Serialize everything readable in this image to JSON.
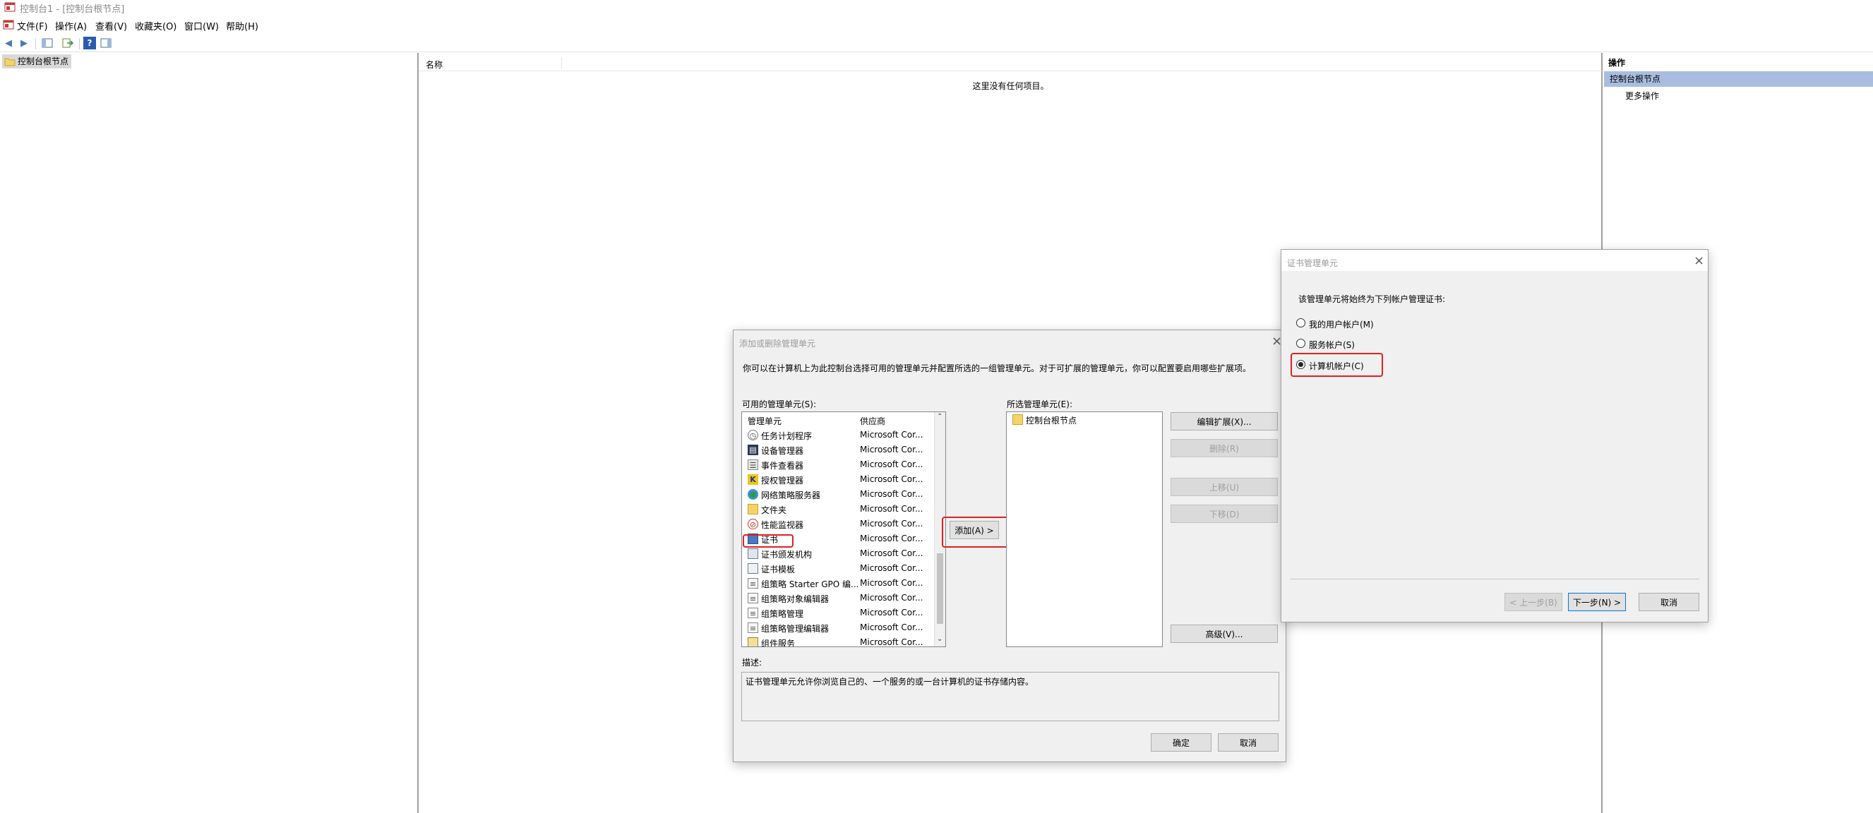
{
  "window": {
    "title": "控制台1 - [控制台根节点]"
  },
  "menu": {
    "items": [
      "文件(F)",
      "操作(A)",
      "查看(V)",
      "收藏夹(O)",
      "窗口(W)",
      "帮助(H)"
    ]
  },
  "toolbar": {
    "icons": [
      "back-arrow-icon",
      "forward-arrow-icon",
      "show-hide-tree-icon",
      "export-list-icon",
      "help-icon",
      "show-hide-action-pane-icon"
    ]
  },
  "tree": {
    "root_label": "控制台根节点"
  },
  "center": {
    "column_name": "名称",
    "empty_message": "这里没有任何项目。"
  },
  "actions": {
    "header": "操作",
    "selected": "控制台根节点",
    "more": "更多操作"
  },
  "add_remove_dialog": {
    "title": "添加或删除管理单元",
    "intro": "你可以在计算机上为此控制台选择可用的管理单元并配置所选的一组管理单元。对于可扩展的管理单元，你可以配置要启用哪些扩展项。",
    "available_label": "可用的管理单元(S):",
    "col_snapin": "管理单元",
    "col_vendor": "供应商",
    "snapins": [
      {
        "name": "任务计划程序",
        "vendor": "Microsoft Cor..."
      },
      {
        "name": "设备管理器",
        "vendor": "Microsoft Cor..."
      },
      {
        "name": "事件查看器",
        "vendor": "Microsoft Cor..."
      },
      {
        "name": "授权管理器",
        "vendor": "Microsoft Cor..."
      },
      {
        "name": "网络策略服务器",
        "vendor": "Microsoft Cor..."
      },
      {
        "name": "文件夹",
        "vendor": "Microsoft Cor..."
      },
      {
        "name": "性能监视器",
        "vendor": "Microsoft Cor..."
      },
      {
        "name": "证书",
        "vendor": "Microsoft Cor..."
      },
      {
        "name": "证书颁发机构",
        "vendor": "Microsoft Cor..."
      },
      {
        "name": "证书模板",
        "vendor": "Microsoft Cor..."
      },
      {
        "name": "组策略 Starter GPO 编...",
        "vendor": "Microsoft Cor..."
      },
      {
        "name": "组策略对象编辑器",
        "vendor": "Microsoft Cor..."
      },
      {
        "name": "组策略管理",
        "vendor": "Microsoft Cor..."
      },
      {
        "name": "组策略管理编辑器",
        "vendor": "Microsoft Cor..."
      },
      {
        "name": "组件服务",
        "vendor": "Microsoft Cor..."
      }
    ],
    "add_button": "添加(A) >",
    "selected_label": "所选管理单元(E):",
    "selected_items": [
      "控制台根节点"
    ],
    "edit_ext_button": "编辑扩展(X)...",
    "remove_button": "删除(R)",
    "move_up_button": "上移(U)",
    "move_down_button": "下移(D)",
    "advanced_button": "高级(V)...",
    "desc_label": "描述:",
    "desc_text": "证书管理单元允许你浏览自己的、一个服务的或一台计算机的证书存储内容。",
    "ok_button": "确定",
    "cancel_button": "取消"
  },
  "cert_dialog": {
    "title": "证书管理单元",
    "prompt": "该管理单元将始终为下列帐户管理证书:",
    "options": [
      "我的用户帐户(M)",
      "服务帐户(S)",
      "计算机帐户(C)"
    ],
    "selected_index": 2,
    "back_button": "< 上一步(B)",
    "next_button": "下一步(N) >",
    "cancel_button": "取消"
  },
  "colors": {
    "selection": "#a9bde0",
    "highlight": "#e02020",
    "dialog_bg": "#f0f0f0"
  }
}
